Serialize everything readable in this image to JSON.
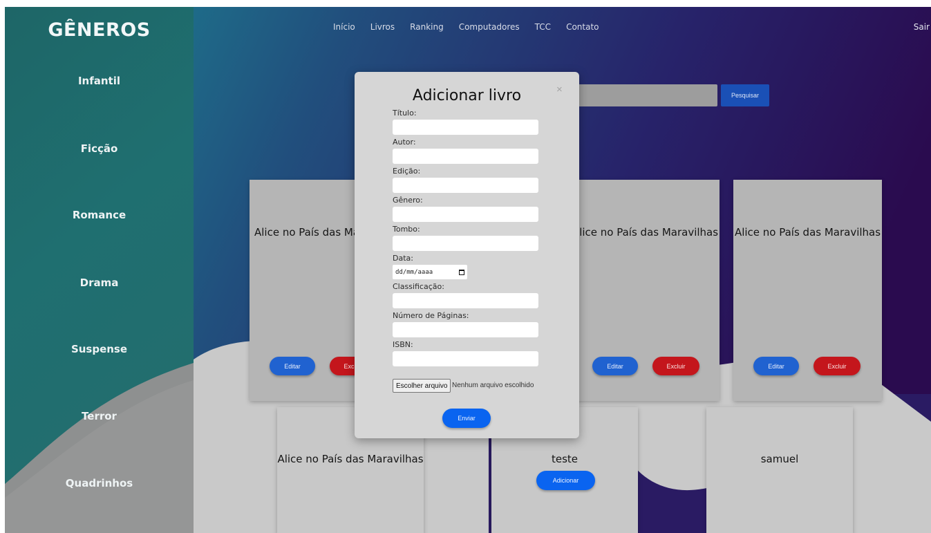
{
  "sidebar": {
    "title": "GÊNEROS",
    "genres": [
      "Infantil",
      "Ficção",
      "Romance",
      "Drama",
      "Suspense",
      "Terror",
      "Quadrinhos"
    ]
  },
  "nav": {
    "items": [
      "Início",
      "Livros",
      "Ranking",
      "Computadores",
      "TCC",
      "Contato"
    ],
    "logout": "Sair"
  },
  "search": {
    "value": "",
    "button_label": "Pesquisar"
  },
  "cards_row1": [
    {
      "title": "Alice no País das Maravilhas",
      "edit_label": "Editar",
      "delete_label": "Excluir"
    },
    {
      "title": "Alice no País das Maravilhas",
      "edit_label": "Editar",
      "delete_label": "Excluir"
    },
    {
      "title": "Alice no País das Maravilhas",
      "edit_label": "Editar",
      "delete_label": "Excluir"
    }
  ],
  "cards_row2": [
    {
      "title": "Alice no País das Maravilhas"
    },
    {
      "title": "teste",
      "add_label": "Adicionar"
    },
    {
      "title": "samuel"
    }
  ],
  "modal": {
    "title": "Adicionar livro",
    "close": "×",
    "fields": {
      "titulo": {
        "label": "Título:",
        "value": ""
      },
      "autor": {
        "label": "Autor:",
        "value": ""
      },
      "edicao": {
        "label": "Edição:",
        "value": ""
      },
      "genero": {
        "label": "Gênero:",
        "value": ""
      },
      "tombo": {
        "label": "Tombo:",
        "value": ""
      },
      "data": {
        "label": "Data:",
        "placeholder": "dd/mm/aaaa"
      },
      "classificacao": {
        "label": "Classificação:",
        "value": ""
      },
      "paginas": {
        "label": "Número de Páginas:",
        "value": ""
      },
      "isbn": {
        "label": "ISBN:",
        "value": ""
      }
    },
    "file_button": "Escolher arquivo",
    "file_status": "Nenhum arquivo escolhido",
    "submit": "Enviar"
  },
  "colors": {
    "sidebar_teal": "#1f6f70",
    "header_navy": "#2a2a6e",
    "header_purple": "#2c0f52",
    "primary_blue": "#0a64f0",
    "danger_red": "#c4161c",
    "card_gray": "#b5b5b5",
    "modal_gray": "#d6d6d6"
  }
}
